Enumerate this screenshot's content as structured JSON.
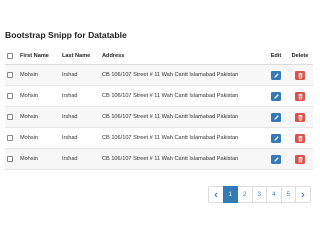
{
  "page": {
    "title": "Bootstrap Snipp for Datatable"
  },
  "table": {
    "headers": {
      "first_name": "First Name",
      "last_name": "Last Name",
      "address": "Address",
      "edit": "Edit",
      "delete": "Delete"
    },
    "rows": [
      {
        "first_name": "Mohsin",
        "last_name": "Irshad",
        "address": "CB 106/107 Street # 11 Wah Cantt Islamabad Pakistan",
        "checked": false
      },
      {
        "first_name": "Mohsin",
        "last_name": "Irshad",
        "address": "CB 106/107 Street # 11 Wah Cantt Islamabad Pakistan",
        "checked": false
      },
      {
        "first_name": "Mohsin",
        "last_name": "Irshad",
        "address": "CB 106/107 Street # 11 Wah Cantt Islamabad Pakistan",
        "checked": false
      },
      {
        "first_name": "Mohsin",
        "last_name": "Irshad",
        "address": "CB 106/107 Street # 11 Wah Cantt Islamabad Pakistan",
        "checked": false
      },
      {
        "first_name": "Mohsin",
        "last_name": "Irshad",
        "address": "CB 106/107 Street # 11 Wah Cantt Islamabad Pakistan",
        "checked": false
      }
    ],
    "edit_icon": "pencil-icon",
    "delete_icon": "trash-icon"
  },
  "pagination": {
    "prev_icon": "chevron-left-icon",
    "next_icon": "chevron-right-icon",
    "pages": [
      "1",
      "2",
      "3",
      "4",
      "5"
    ],
    "active_page": "1"
  },
  "colors": {
    "primary": "#337ab7",
    "danger": "#d9534f"
  }
}
